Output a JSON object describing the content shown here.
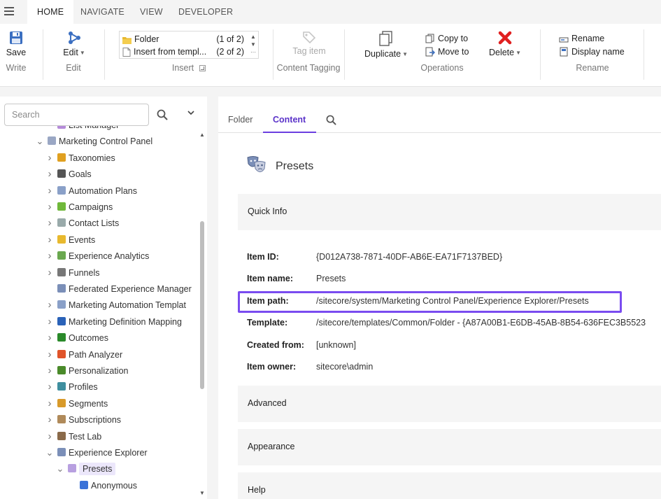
{
  "ribbon_tabs": [
    {
      "label": "HOME",
      "active": true
    },
    {
      "label": "NAVIGATE"
    },
    {
      "label": "VIEW"
    },
    {
      "label": "DEVELOPER"
    }
  ],
  "ribbon": {
    "write": {
      "save_label": "Save",
      "group_label": "Write"
    },
    "edit": {
      "edit_label": "Edit",
      "group_label": "Edit"
    },
    "insert": {
      "items": [
        {
          "label": "Folder",
          "count": "(1 of 2)"
        },
        {
          "label": "Insert from templ...",
          "count": "(2 of 2)"
        }
      ],
      "group_label": "Insert"
    },
    "tagging": {
      "tag_label": "Tag item",
      "group_label": "Content Tagging"
    },
    "operations": {
      "duplicate_label": "Duplicate",
      "copy_label": "Copy to",
      "move_label": "Move to",
      "delete_label": "Delete",
      "group_label": "Operations"
    },
    "rename": {
      "rename_label": "Rename",
      "display_label": "Display name",
      "group_label": "Rename"
    }
  },
  "search": {
    "placeholder": "Search"
  },
  "tree": {
    "items": [
      {
        "label": "List Manager",
        "level": 2,
        "twisty": ""
      },
      {
        "label": "Marketing Control Panel",
        "level": 1,
        "twisty": "v"
      },
      {
        "label": "Taxonomies",
        "level": 2,
        "twisty": ">"
      },
      {
        "label": "Goals",
        "level": 2,
        "twisty": ">"
      },
      {
        "label": "Automation Plans",
        "level": 2,
        "twisty": ">"
      },
      {
        "label": "Campaigns",
        "level": 2,
        "twisty": ">"
      },
      {
        "label": "Contact Lists",
        "level": 2,
        "twisty": ">"
      },
      {
        "label": "Events",
        "level": 2,
        "twisty": ">"
      },
      {
        "label": "Experience Analytics",
        "level": 2,
        "twisty": ">"
      },
      {
        "label": "Funnels",
        "level": 2,
        "twisty": ">"
      },
      {
        "label": "Federated Experience Manager",
        "level": 2,
        "twisty": ""
      },
      {
        "label": "Marketing Automation Templat",
        "level": 2,
        "twisty": ">"
      },
      {
        "label": "Marketing Definition Mapping",
        "level": 2,
        "twisty": ">"
      },
      {
        "label": "Outcomes",
        "level": 2,
        "twisty": ">"
      },
      {
        "label": "Path Analyzer",
        "level": 2,
        "twisty": ">"
      },
      {
        "label": "Personalization",
        "level": 2,
        "twisty": ">"
      },
      {
        "label": "Profiles",
        "level": 2,
        "twisty": ">"
      },
      {
        "label": "Segments",
        "level": 2,
        "twisty": ">"
      },
      {
        "label": "Subscriptions",
        "level": 2,
        "twisty": ">"
      },
      {
        "label": "Test Lab",
        "level": 2,
        "twisty": ">"
      },
      {
        "label": "Experience Explorer",
        "level": 2,
        "twisty": "v"
      },
      {
        "label": "Presets",
        "level": 3,
        "twisty": "v",
        "selected": true
      },
      {
        "label": "Anonymous",
        "level": 4,
        "twisty": ""
      }
    ]
  },
  "content_tabs": [
    {
      "label": "Folder"
    },
    {
      "label": "Content",
      "active": true
    }
  ],
  "item": {
    "title": "Presets",
    "sections": {
      "quick_info": "Quick Info",
      "advanced": "Advanced",
      "appearance": "Appearance",
      "help": "Help"
    },
    "fields": [
      {
        "key": "Item ID:",
        "value": "{D012A738-7871-40DF-AB6E-EA71F7137BED}"
      },
      {
        "key": "Item name:",
        "value": "Presets"
      },
      {
        "key": "Item path:",
        "value": "/sitecore/system/Marketing Control Panel/Experience Explorer/Presets"
      },
      {
        "key": "Template:",
        "value": "/sitecore/templates/Common/Folder - {A87A00B1-E6DB-45AB-8B54-636FEC3B5523"
      },
      {
        "key": "Created from:",
        "value": "[unknown]"
      },
      {
        "key": "Item owner:",
        "value": "sitecore\\admin"
      }
    ]
  },
  "colors": {
    "accent": "#6b3fe0",
    "highlight_border": "#7a4cf0",
    "delete_red": "#e02020",
    "save_blue": "#3b6fc1"
  }
}
